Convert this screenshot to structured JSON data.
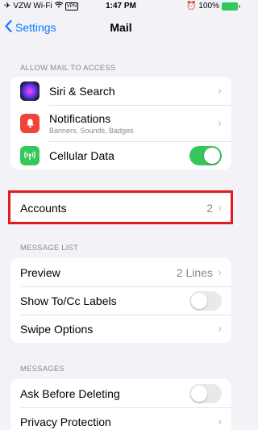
{
  "status_bar": {
    "carrier": "VZW Wi-Fi",
    "vpn": "VPN",
    "time": "1:47 PM",
    "battery": "100%"
  },
  "nav": {
    "back_label": "Settings",
    "title": "Mail"
  },
  "sections": {
    "allow_access": {
      "header": "ALLOW MAIL TO ACCESS",
      "siri_label": "Siri & Search",
      "notifications_label": "Notifications",
      "notifications_sub": "Banners, Sounds, Badges",
      "cellular_label": "Cellular Data",
      "cellular_on": true
    },
    "accounts": {
      "label": "Accounts",
      "value": "2"
    },
    "message_list": {
      "header": "MESSAGE LIST",
      "preview_label": "Preview",
      "preview_value": "2 Lines",
      "show_tocc_label": "Show To/Cc Labels",
      "show_tocc_on": false,
      "swipe_label": "Swipe Options"
    },
    "messages": {
      "header": "MESSAGES",
      "ask_delete_label": "Ask Before Deleting",
      "ask_delete_on": false,
      "privacy_label": "Privacy Protection"
    }
  },
  "colors": {
    "accent": "#0a7aff",
    "toggle_on": "#34c759",
    "highlight": "#e21b23",
    "background": "#f2f2f7"
  },
  "icons": {
    "chevron": "›",
    "back": "chevron-left-icon"
  }
}
